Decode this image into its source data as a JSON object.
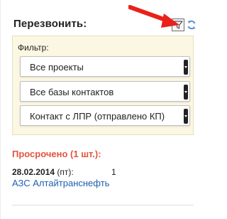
{
  "header": {
    "title": "Перезвонить:",
    "filter_icon": "filter-funnel-icon",
    "refresh_icon": "refresh-icon"
  },
  "annotation": {
    "arrow_color": "#e8221b"
  },
  "filter_panel": {
    "label": "Фильтр:",
    "background": "#fbf7e2",
    "selects": [
      {
        "value": "Все проекты"
      },
      {
        "value": "Все базы контактов"
      },
      {
        "value": "Контакт с ЛПР (отправлено КП)"
      }
    ]
  },
  "overdue": {
    "label": "Просрочено (1 шт.):",
    "color": "#e5533b"
  },
  "task": {
    "date": "28.02.2014",
    "weekday": " (пт):",
    "count": "1",
    "link": "АЗС Алтайтранснефть",
    "link_color": "#1f5fb3"
  }
}
